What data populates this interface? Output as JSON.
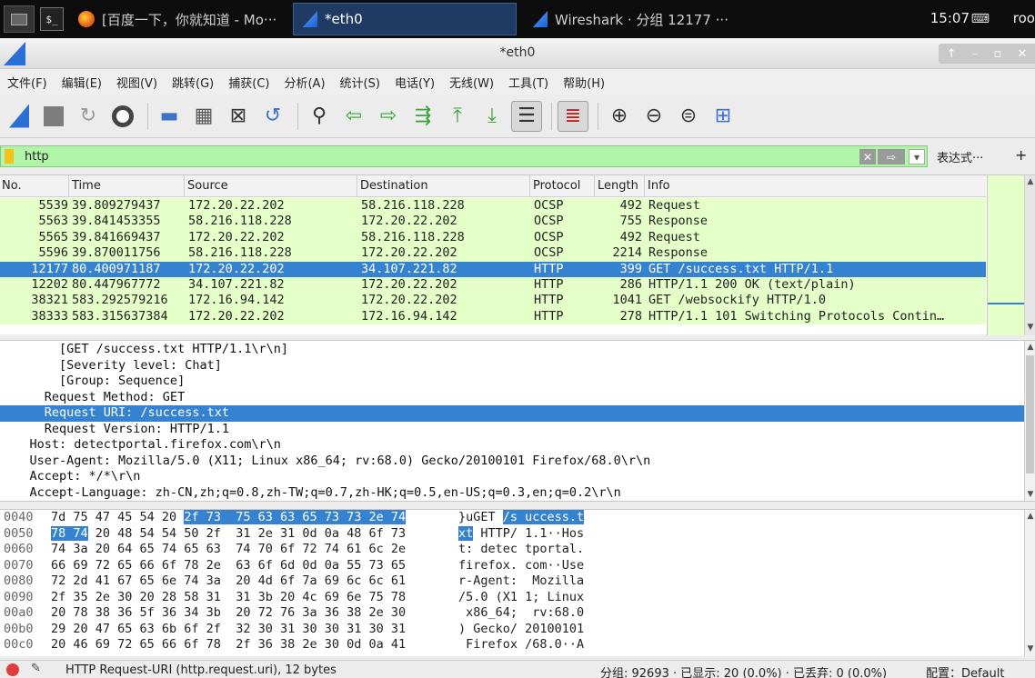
{
  "taskbar": {
    "tasks": [
      {
        "label": "[百度一下，你就知道 - Mo···",
        "icon": "firefox-icon"
      },
      {
        "label": "*eth0",
        "icon": "wireshark-icon"
      },
      {
        "label": "Wireshark · 分组 12177 ···",
        "icon": "wireshark-icon"
      }
    ],
    "clock": "15:07",
    "user": "roo"
  },
  "window": {
    "title": "*eth0"
  },
  "menu": [
    "文件(F)",
    "编辑(E)",
    "视图(V)",
    "跳转(G)",
    "捕获(C)",
    "分析(A)",
    "统计(S)",
    "电话(Y)",
    "无线(W)",
    "工具(T)",
    "帮助(H)"
  ],
  "filter": {
    "value": "http",
    "expression_label": "表达式···",
    "plus": "+"
  },
  "packet_list": {
    "columns": [
      "No.",
      "Time",
      "Source",
      "Destination",
      "Protocol",
      "Length",
      "Info"
    ],
    "rows": [
      {
        "no": "5539",
        "time": "39.809279437",
        "src": "172.20.22.202",
        "dst": "58.216.118.228",
        "proto": "OCSP",
        "len": "492",
        "info": "Request"
      },
      {
        "no": "5563",
        "time": "39.841453355",
        "src": "58.216.118.228",
        "dst": "172.20.22.202",
        "proto": "OCSP",
        "len": "755",
        "info": "Response"
      },
      {
        "no": "5565",
        "time": "39.841669437",
        "src": "172.20.22.202",
        "dst": "58.216.118.228",
        "proto": "OCSP",
        "len": "492",
        "info": "Request"
      },
      {
        "no": "5596",
        "time": "39.870011756",
        "src": "58.216.118.228",
        "dst": "172.20.22.202",
        "proto": "OCSP",
        "len": "2214",
        "info": "Response"
      },
      {
        "no": "12177",
        "time": "80.400971187",
        "src": "172.20.22.202",
        "dst": "34.107.221.82",
        "proto": "HTTP",
        "len": "399",
        "info": "GET /success.txt HTTP/1.1"
      },
      {
        "no": "12202",
        "time": "80.447967772",
        "src": "34.107.221.82",
        "dst": "172.20.22.202",
        "proto": "HTTP",
        "len": "286",
        "info": "HTTP/1.1 200 OK  (text/plain)"
      },
      {
        "no": "38321",
        "time": "583.292579216",
        "src": "172.16.94.142",
        "dst": "172.20.22.202",
        "proto": "HTTP",
        "len": "1041",
        "info": "GET /websockify HTTP/1.0"
      },
      {
        "no": "38333",
        "time": "583.315637384",
        "src": "172.20.22.202",
        "dst": "172.16.94.142",
        "proto": "HTTP",
        "len": "278",
        "info": "HTTP/1.1 101 Switching Protocols Contin…"
      }
    ]
  },
  "details": [
    "        [GET /success.txt HTTP/1.1\\r\\n]",
    "        [Severity level: Chat]",
    "        [Group: Sequence]",
    "      Request Method: GET",
    "      Request URI: /success.txt",
    "      Request Version: HTTP/1.1",
    "    Host: detectportal.firefox.com\\r\\n",
    "    User-Agent: Mozilla/5.0 (X11; Linux x86_64; rv:68.0) Gecko/20100101 Firefox/68.0\\r\\n",
    "    Accept: */*\\r\\n",
    "    Accept-Language: zh-CN,zh;q=0.8,zh-TW;q=0.7,zh-HK;q=0.5,en-US;q=0.3,en;q=0.2\\r\\n"
  ],
  "hex": [
    {
      "off": "0040",
      "a": "7d 75 47 45 54 20 ",
      "h": "2f 73  75 63 63 65 73 73 2e 74",
      "b": "",
      "ascii_a": "}uGET ",
      "ascii_h": "/s uccess.t",
      "ascii_b": ""
    },
    {
      "off": "0050",
      "a": "",
      "h": "78 74",
      "b": " 20 48 54 54 50 2f  31 2e 31 0d 0a 48 6f 73",
      "ascii_a": "",
      "ascii_h": "xt",
      "ascii_b": " HTTP/ 1.1··Hos"
    },
    {
      "off": "0060",
      "a": "74 3a 20 64 65 74 65 63  74 70 6f 72 74 61 6c 2e",
      "h": "",
      "b": "",
      "ascii_a": "t: detec tportal.",
      "ascii_h": "",
      "ascii_b": ""
    },
    {
      "off": "0070",
      "a": "66 69 72 65 66 6f 78 2e  63 6f 6d 0d 0a 55 73 65",
      "h": "",
      "b": "",
      "ascii_a": "firefox. com··Use",
      "ascii_h": "",
      "ascii_b": ""
    },
    {
      "off": "0080",
      "a": "72 2d 41 67 65 6e 74 3a  20 4d 6f 7a 69 6c 6c 61",
      "h": "",
      "b": "",
      "ascii_a": "r-Agent:  Mozilla",
      "ascii_h": "",
      "ascii_b": ""
    },
    {
      "off": "0090",
      "a": "2f 35 2e 30 20 28 58 31  31 3b 20 4c 69 6e 75 78",
      "h": "",
      "b": "",
      "ascii_a": "/5.0 (X1 1; Linux",
      "ascii_h": "",
      "ascii_b": ""
    },
    {
      "off": "00a0",
      "a": "20 78 38 36 5f 36 34 3b  20 72 76 3a 36 38 2e 30",
      "h": "",
      "b": "",
      "ascii_a": " x86_64;  rv:68.0",
      "ascii_h": "",
      "ascii_b": ""
    },
    {
      "off": "00b0",
      "a": "29 20 47 65 63 6b 6f 2f  32 30 31 30 30 31 30 31",
      "h": "",
      "b": "",
      "ascii_a": ") Gecko/ 20100101",
      "ascii_h": "",
      "ascii_b": ""
    },
    {
      "off": "00c0",
      "a": "20 46 69 72 65 66 6f 78  2f 36 38 2e 30 0d 0a 41",
      "h": "",
      "b": "",
      "ascii_a": " Firefox /68.0··A",
      "ascii_h": "",
      "ascii_b": ""
    }
  ],
  "status": {
    "field": "HTTP Request-URI (http.request.uri), 12 bytes",
    "stats": "分组: 92693 · 已显示: 20 (0.0%) · 已丢弃: 0 (0.0%)",
    "profile": "配置：Default"
  },
  "colors": {
    "selected": "#3583d0",
    "row_bg": "#e4ffc7",
    "filter_bg": "#b0f5a8"
  }
}
